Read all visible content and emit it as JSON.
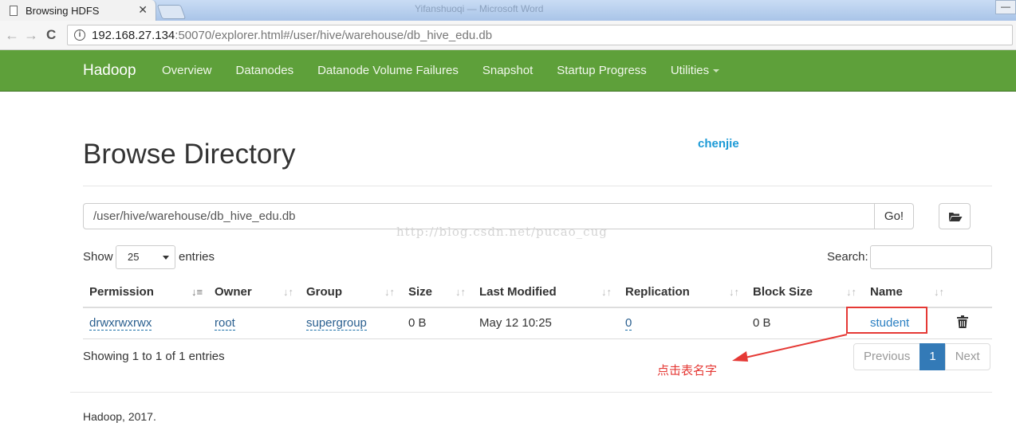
{
  "browser": {
    "tab_title": "Browsing HDFS",
    "tab_close": "✕",
    "window_title_blurred": "Yifanshuoqi — Microsoft Word",
    "url_host": "192.168.27.134",
    "url_rest": ":50070/explorer.html#/user/hive/warehouse/db_hive_edu.db",
    "back_glyph": "←",
    "forward_glyph": "→",
    "reload_glyph": "C",
    "minimize_glyph": "—"
  },
  "navbar": {
    "brand": "Hadoop",
    "links": [
      "Overview",
      "Datanodes",
      "Datanode Volume Failures",
      "Snapshot",
      "Startup Progress",
      "Utilities"
    ],
    "bg_color": "#5ea03a"
  },
  "page": {
    "title": "Browse Directory",
    "blog_author": "chenjie",
    "path_value": "/user/hive/warehouse/db_hive_edu.db",
    "go_label": "Go!",
    "watermark": "http://blog.csdn.net/pucao_cug",
    "show_label": "Show",
    "entries_value": "25",
    "entries_label": "entries",
    "search_label": "Search:"
  },
  "table": {
    "headers": [
      "Permission",
      "Owner",
      "Group",
      "Size",
      "Last Modified",
      "Replication",
      "Block Size",
      "Name"
    ],
    "rows": [
      {
        "permission": "drwxrwxrwx",
        "owner": "root",
        "group": "supergroup",
        "size": "0 B",
        "last_modified": "May 12 10:25",
        "replication": "0",
        "block_size": "0 B",
        "name": "student"
      }
    ]
  },
  "summary": {
    "showing": "Showing 1 to 1 of 1 entries",
    "prev_label": "Previous",
    "current_page": "1",
    "next_label": "Next"
  },
  "annotation": {
    "text": "点击表名字",
    "color": "#e53935"
  },
  "footer": {
    "text": "Hadoop, 2017."
  }
}
